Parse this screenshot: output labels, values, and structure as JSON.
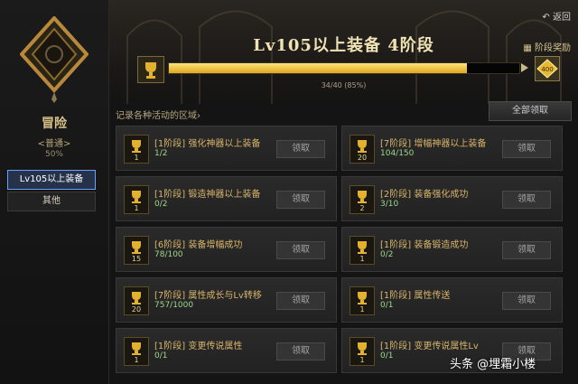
{
  "sidebar": {
    "category_title": "冒险",
    "category_sub": "<普通>",
    "category_percent": "50%",
    "nav": [
      {
        "label": "Lv105以上装备",
        "active": true
      },
      {
        "label": "其他",
        "active": false
      }
    ]
  },
  "header": {
    "back_label": "返回",
    "title": "Lv105以上装备 4阶段",
    "reward_label": "阶段奖励",
    "progress": {
      "current": 34,
      "total": 40,
      "percent": 85,
      "text": "34/40 (85%)"
    },
    "gift_badge": "400"
  },
  "area_label": "记录各种活动的区域",
  "claim_all_label": "全部领取",
  "claim_label": "领取",
  "cards": [
    {
      "name": "[1阶段] 强化神器以上装备",
      "progress": "1/2",
      "count": "1"
    },
    {
      "name": "[7阶段] 增幅神器以上装备",
      "progress": "104/150",
      "count": "20"
    },
    {
      "name": "[1阶段] 锻造神器以上装备",
      "progress": "0/2",
      "count": "1"
    },
    {
      "name": "[2阶段] 装备强化成功",
      "progress": "3/10",
      "count": "2"
    },
    {
      "name": "[6阶段] 装备增幅成功",
      "progress": "78/100",
      "count": "15"
    },
    {
      "name": "[1阶段] 装备锻造成功",
      "progress": "0/2",
      "count": "1"
    },
    {
      "name": "[7阶段] 属性成长与Lv转移",
      "progress": "757/1000",
      "count": "20"
    },
    {
      "name": "[1阶段] 属性传送",
      "progress": "0/1",
      "count": "1"
    },
    {
      "name": "[1阶段] 变更传说属性",
      "progress": "0/1",
      "count": "1"
    },
    {
      "name": "[1阶段] 变更传说属性Lv",
      "progress": "0/1",
      "count": "1"
    }
  ],
  "watermark": "头条 @埋霜小楼",
  "colors": {
    "accent": "#f0b429",
    "progress_text": "#9fd68a",
    "active_nav": "#6aa0ff"
  }
}
